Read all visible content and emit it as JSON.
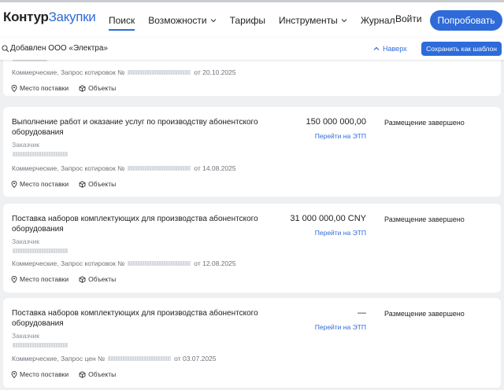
{
  "header": {
    "logo_part1": "Контур",
    "logo_part2": "Закупки",
    "nav": [
      {
        "label": "Поиск",
        "active": true,
        "dropdown": false
      },
      {
        "label": "Возможности",
        "active": false,
        "dropdown": true
      },
      {
        "label": "Тарифы",
        "active": false,
        "dropdown": false
      },
      {
        "label": "Инструменты",
        "active": false,
        "dropdown": true
      },
      {
        "label": "Журнал",
        "active": false,
        "dropdown": false
      }
    ],
    "login_label": "Войти",
    "try_label": "Попробовать"
  },
  "toolbar": {
    "search_text": "Добавлен ООО «Электра»",
    "up_label": "Наверх",
    "save_label": "Сохранить как шаблон"
  },
  "partial_card": {
    "meta_prefix": "Коммерческие, Запрос котировок №",
    "meta_date": "от 20.10.2025",
    "place_label": "Место поставки",
    "objects_label": "Объекты"
  },
  "cards": [
    {
      "title": "Выполнение работ и оказание услуг по производству абонентского оборудования",
      "price": "150 000 000,00",
      "etp_label": "Перейти на ЭТП",
      "status": "Размещение завершено",
      "customer_label": "Заказчик",
      "meta_prefix": "Коммерческие, Запрос котировок №",
      "meta_date": "от 14.08.2025",
      "place_label": "Место поставки",
      "objects_label": "Объекты"
    },
    {
      "title": "Поставка наборов комплектующих для производства абонентского оборудования",
      "price": "31 000 000,00 CNY",
      "etp_label": "Перейти на ЭТП",
      "status": "Размещение завершено",
      "customer_label": "Заказчик",
      "meta_prefix": "Коммерческие, Запрос котировок №",
      "meta_date": "от 12.08.2025",
      "place_label": "Место поставки",
      "objects_label": "Объекты"
    },
    {
      "title": "Поставка наборов комплектующих для производства абонентского оборудования",
      "price": "—",
      "etp_label": "Перейти на ЭТП",
      "status": "Размещение завершено",
      "customer_label": "Заказчик",
      "meta_prefix": "Коммерческие, Запрос цен №",
      "meta_date": "от 03.07.2025",
      "place_label": "Место поставки",
      "objects_label": "Объекты"
    }
  ],
  "colors": {
    "accent": "#2e6bd9",
    "background": "#eef0f2",
    "muted_text": "#8a8f96"
  }
}
